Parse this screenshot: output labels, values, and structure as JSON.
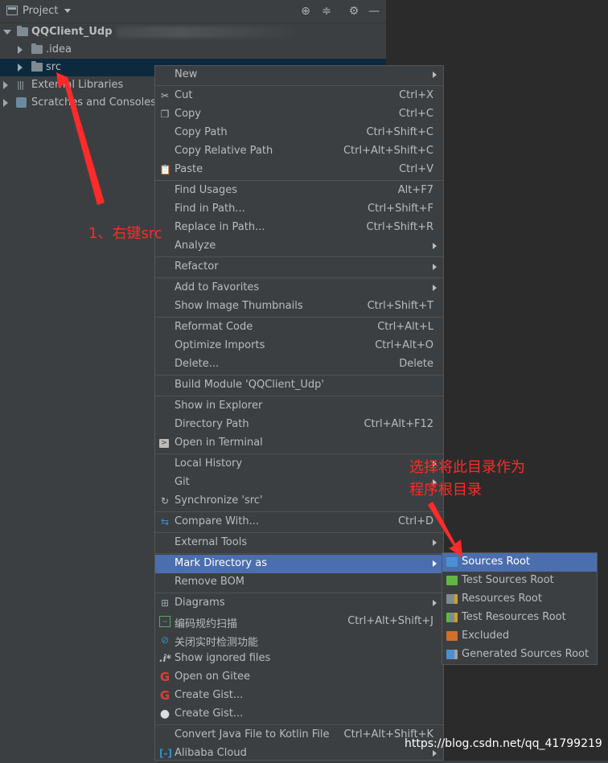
{
  "toolbar": {
    "title": "Project"
  },
  "tree": {
    "root": "QQClient_Udp",
    "idea": ".idea",
    "src": "src",
    "external": "External Libraries",
    "scratches": "Scratches and Consoles"
  },
  "menu": {
    "new": "New",
    "cut": "Cut",
    "cut_sc": "Ctrl+X",
    "copy": "Copy",
    "copy_sc": "Ctrl+C",
    "copy_path": "Copy Path",
    "copy_path_sc": "Ctrl+Shift+C",
    "copy_rel": "Copy Relative Path",
    "copy_rel_sc": "Ctrl+Alt+Shift+C",
    "paste": "Paste",
    "paste_sc": "Ctrl+V",
    "find_usages": "Find Usages",
    "find_usages_sc": "Alt+F7",
    "find_in_path": "Find in Path...",
    "find_in_path_sc": "Ctrl+Shift+F",
    "replace_in_path": "Replace in Path...",
    "replace_in_path_sc": "Ctrl+Shift+R",
    "analyze": "Analyze",
    "refactor": "Refactor",
    "add_fav": "Add to Favorites",
    "show_thumbs": "Show Image Thumbnails",
    "show_thumbs_sc": "Ctrl+Shift+T",
    "reformat": "Reformat Code",
    "reformat_sc": "Ctrl+Alt+L",
    "optimize": "Optimize Imports",
    "optimize_sc": "Ctrl+Alt+O",
    "delete": "Delete...",
    "delete_sc": "Delete",
    "build": "Build Module 'QQClient_Udp'",
    "show_explorer": "Show in Explorer",
    "dir_path": "Directory Path",
    "dir_path_sc": "Ctrl+Alt+F12",
    "open_terminal": "Open in Terminal",
    "local_history": "Local History",
    "git": "Git",
    "sync": "Synchronize 'src'",
    "compare": "Compare With...",
    "compare_sc": "Ctrl+D",
    "ext_tools": "External Tools",
    "mark_dir": "Mark Directory as",
    "remove_bom": "Remove BOM",
    "diagrams": "Diagrams",
    "scan": "编码规约扫描",
    "scan_sc": "Ctrl+Alt+Shift+J",
    "close_detect": "关闭实时检测功能",
    "show_ignored": "Show ignored files",
    "open_gitee": "Open on Gitee",
    "create_gist1": "Create Gist...",
    "create_gist2": "Create Gist...",
    "convert": "Convert Java File to Kotlin File",
    "convert_sc": "Ctrl+Alt+Shift+K",
    "alibaba": "Alibaba Cloud"
  },
  "submenu": {
    "sources": "Sources Root",
    "test_sources": "Test Sources Root",
    "resources": "Resources Root",
    "test_resources": "Test Resources Root",
    "excluded": "Excluded",
    "generated": "Generated Sources Root"
  },
  "annotations": {
    "step1": "1、右键src",
    "step2_line1": "选择将此目录作为",
    "step2_line2": "程序根目录"
  },
  "watermark": "https://blog.csdn.net/qq_41799219",
  "colors": {
    "highlight": "#4b6eaf",
    "annotation": "#ff2a2a",
    "menu_bg": "#3c3f41"
  }
}
